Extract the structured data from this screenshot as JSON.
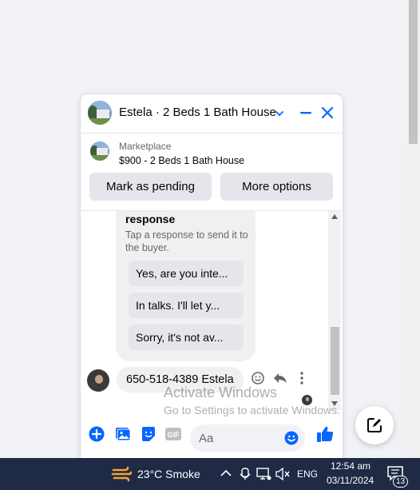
{
  "chat": {
    "title": "Estela · 2 Beds 1 Bath House",
    "listing": {
      "kicker": "Marketplace",
      "title": "$900 - 2 Beds 1 Bath House"
    },
    "actions": {
      "mark_pending": "Mark as pending",
      "more_options": "More options"
    },
    "suggestions": {
      "heading": "response",
      "help": "Tap a response to send it to the buyer.",
      "items": [
        "Yes, are you inte...",
        "In talks. I'll let y...",
        "Sorry, it's not av..."
      ]
    },
    "last_message": "650-518-4389 Estela",
    "composer_placeholder": "Aa"
  },
  "watermark": {
    "line1": "Activate Windows",
    "line2": "Go to Settings to activate Windows."
  },
  "taskbar": {
    "weather": "23°C  Smoke",
    "language": "ENG",
    "time": "12:54 am",
    "date": "03/11/2024",
    "notifications": "13"
  },
  "colors": {
    "accent": "#0866ff",
    "taskbar": "#1f2a44"
  }
}
